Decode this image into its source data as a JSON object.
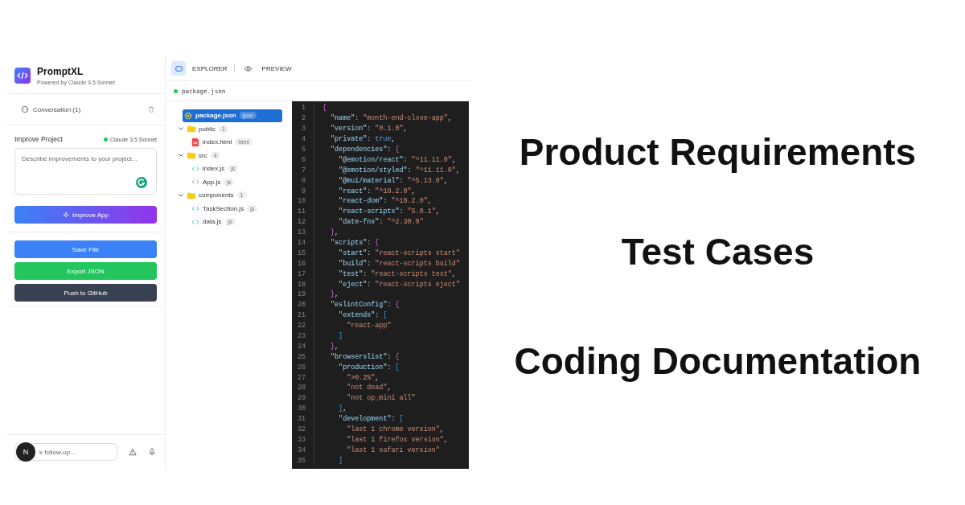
{
  "app": {
    "name": "PromptXL",
    "subtitle": "Powered by Claude 3.5 Sonnet"
  },
  "conversation": {
    "label": "Conversation (1)"
  },
  "improve": {
    "title": "Improve Project",
    "model": "Claude 3.5 Sonnet",
    "placeholder": "Describe improvements to your project...",
    "button": "Improve App"
  },
  "actions": [
    {
      "label": "Save File",
      "kind": "save"
    },
    {
      "label": "Export JSON",
      "kind": "export"
    },
    {
      "label": "Push to GitHub",
      "kind": "push"
    }
  ],
  "followup": {
    "avatar": "N",
    "placeholder": "k follow-up..."
  },
  "tabs": [
    {
      "label": "EXPLORER",
      "kind": "explorer",
      "selected": true
    },
    {
      "label": "PREVIEW",
      "kind": "preview",
      "selected": false
    }
  ],
  "open_file": "package.json",
  "tree": [
    {
      "name": "package.json",
      "kind": "config",
      "badge": "json",
      "selected": true
    },
    {
      "name": "public",
      "kind": "folder",
      "badge": "1",
      "expanded": true,
      "children": [
        {
          "name": "index.html",
          "kind": "html",
          "badge": "html",
          "selected": false
        }
      ]
    },
    {
      "name": "src",
      "kind": "folder",
      "badge": "4",
      "expanded": true,
      "children": [
        {
          "name": "index.js",
          "kind": "js",
          "badge": "js",
          "selected": false
        },
        {
          "name": "App.js",
          "kind": "js",
          "badge": "js",
          "selected": false
        }
      ]
    },
    {
      "name": "components",
      "kind": "folder",
      "badge": "1",
      "expanded": true,
      "children": [
        {
          "name": "TaskSection.js",
          "kind": "js",
          "badge": "js",
          "selected": false
        },
        {
          "name": "data.js",
          "kind": "js",
          "badge": "js",
          "selected": false
        }
      ]
    }
  ],
  "code": [
    {
      "n": "1",
      "text": "{"
    },
    {
      "n": "2",
      "text": "  \"name\": \"month-end-close-app\","
    },
    {
      "n": "3",
      "text": "  \"version\": \"0.1.0\","
    },
    {
      "n": "4",
      "text": "  \"private\": true,"
    },
    {
      "n": "5",
      "text": "  \"dependencies\": {"
    },
    {
      "n": "6",
      "text": "    \"@emotion/react\": \"^11.11.0\","
    },
    {
      "n": "7",
      "text": "    \"@emotion/styled\": \"^11.11.0\","
    },
    {
      "n": "8",
      "text": "    \"@mui/material\": \"^5.13.0\","
    },
    {
      "n": "9",
      "text": "    \"react\": \"^18.2.0\","
    },
    {
      "n": "10",
      "text": "    \"react-dom\": \"^18.2.0\","
    },
    {
      "n": "11",
      "text": "    \"react-scripts\": \"5.0.1\","
    },
    {
      "n": "12",
      "text": "    \"date-fns\": \"^2.30.0\""
    },
    {
      "n": "13",
      "text": "  },"
    },
    {
      "n": "14",
      "text": "  \"scripts\": {"
    },
    {
      "n": "15",
      "text": "    \"start\": \"react-scripts start\""
    },
    {
      "n": "16",
      "text": "    \"build\": \"react-scripts build\""
    },
    {
      "n": "17",
      "text": "    \"test\": \"react-scripts test\","
    },
    {
      "n": "18",
      "text": "    \"eject\": \"react-scripts eject\""
    },
    {
      "n": "19",
      "text": "  },"
    },
    {
      "n": "20",
      "text": "  \"eslintConfig\": {"
    },
    {
      "n": "21",
      "text": "    \"extends\": ["
    },
    {
      "n": "22",
      "text": "      \"react-app\""
    },
    {
      "n": "23",
      "text": "    ]"
    },
    {
      "n": "24",
      "text": "  },"
    },
    {
      "n": "25",
      "text": "  \"browserslist\": {"
    },
    {
      "n": "26",
      "text": "    \"production\": ["
    },
    {
      "n": "27",
      "text": "      \">0.2%\","
    },
    {
      "n": "28",
      "text": "      \"not dead\","
    },
    {
      "n": "29",
      "text": "      \"not op_mini all\""
    },
    {
      "n": "30",
      "text": "    ],"
    },
    {
      "n": "31",
      "text": "    \"development\": ["
    },
    {
      "n": "32",
      "text": "      \"last 1 chrome version\","
    },
    {
      "n": "33",
      "text": "      \"last 1 firefox version\","
    },
    {
      "n": "34",
      "text": "      \"last 1 safari version\""
    },
    {
      "n": "35",
      "text": "    ]"
    }
  ],
  "headlines": [
    "Product Requirements",
    "Test Cases",
    "Coding Documentation"
  ]
}
